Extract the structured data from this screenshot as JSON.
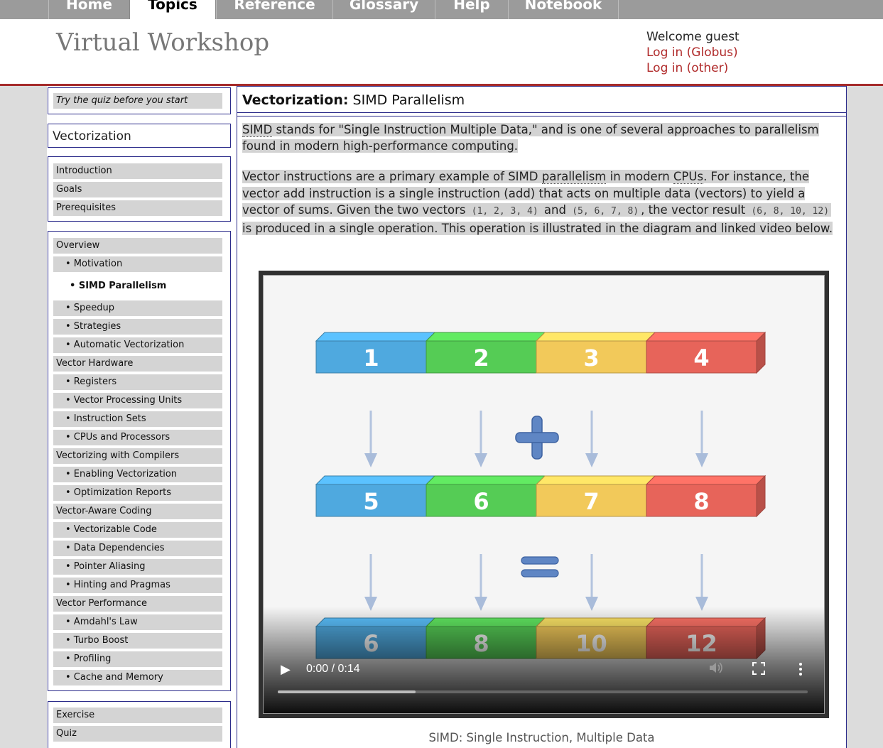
{
  "nav": {
    "tabs": [
      "Home",
      "Topics",
      "Reference",
      "Glossary",
      "Help",
      "Notebook"
    ],
    "active": "Topics"
  },
  "header": {
    "site_title": "Virtual Workshop",
    "welcome": "Welcome guest",
    "login_globus": "Log in (Globus)",
    "login_other": "Log in (other)"
  },
  "sidebar": {
    "quiz_hint": "Try the quiz before you start",
    "section_title": "Vectorization",
    "intro_items": [
      "Introduction",
      "Goals",
      "Prerequisites"
    ],
    "outline": [
      {
        "label": "Overview",
        "sub": false
      },
      {
        "label": "• Motivation",
        "sub": true
      },
      {
        "label": "• SIMD Parallelism",
        "sub": true,
        "current": true
      },
      {
        "label": "• Speedup",
        "sub": true
      },
      {
        "label": "• Strategies",
        "sub": true
      },
      {
        "label": "• Automatic Vectorization",
        "sub": true
      },
      {
        "label": "Vector Hardware",
        "sub": false
      },
      {
        "label": "• Registers",
        "sub": true
      },
      {
        "label": "• Vector Processing Units",
        "sub": true
      },
      {
        "label": "• Instruction Sets",
        "sub": true
      },
      {
        "label": "• CPUs and Processors",
        "sub": true
      },
      {
        "label": "Vectorizing with Compilers",
        "sub": false
      },
      {
        "label": "• Enabling Vectorization",
        "sub": true
      },
      {
        "label": "• Optimization Reports",
        "sub": true
      },
      {
        "label": "Vector-Aware Coding",
        "sub": false
      },
      {
        "label": "• Vectorizable Code",
        "sub": true
      },
      {
        "label": "• Data Dependencies",
        "sub": true
      },
      {
        "label": "• Pointer Aliasing",
        "sub": true
      },
      {
        "label": "• Hinting and Pragmas",
        "sub": true
      },
      {
        "label": "Vector Performance",
        "sub": false
      },
      {
        "label": "• Amdahl's Law",
        "sub": true
      },
      {
        "label": "• Turbo Boost",
        "sub": true
      },
      {
        "label": "• Profiling",
        "sub": true
      },
      {
        "label": "• Cache and Memory",
        "sub": true
      }
    ],
    "bottom_items": [
      "Exercise",
      "Quiz"
    ]
  },
  "main": {
    "title_bold": "Vectorization:",
    "title_rest": " SIMD Parallelism",
    "p1": {
      "abbr": "SIMD",
      "text": " stands for \"Single Instruction Multiple Data,\" and is one of several approaches to parallelism found in modern high-performance computing."
    },
    "p2": {
      "a": "Vector instructions are a primary example of SIMD ",
      "b": "parallelism",
      "c": " in modern ",
      "d": "CPUs",
      "e": ". For instance, the vector add instruction is a single instruction (add) that acts on multiple data (vectors) to yield a vector of sums. Given the two vectors ",
      "code1": "(1, 2, 3, 4)",
      "f": " and ",
      "code2": "(5, 6, 7, 8)",
      "g": ", the vector result ",
      "code3": "(6, 8, 10, 12)",
      "h": " is produced in a single operation. This operation is illustrated in the diagram and linked video below."
    },
    "video": {
      "row1": [
        "1",
        "2",
        "3",
        "4"
      ],
      "row2": [
        "5",
        "6",
        "7",
        "8"
      ],
      "row3": [
        "6",
        "8",
        "10",
        "12"
      ],
      "op_plus": "+",
      "op_equals": "=",
      "time": "0:00 / 0:14",
      "progress": 0.26
    },
    "caption": "SIMD: Single Instruction, Multiple Data"
  },
  "colors": {
    "blue": "#4fa9df",
    "green": "#55cc55",
    "yellow": "#f2c95a",
    "red": "#e7645a",
    "nav_gray": "#9b9b9b",
    "brand_red": "#a52a2a"
  }
}
